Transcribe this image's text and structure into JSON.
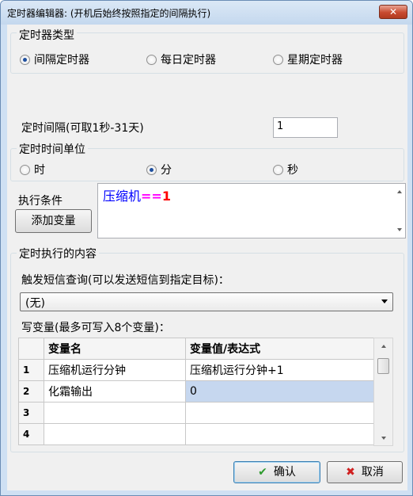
{
  "window": {
    "title": "定时器编辑器: (开机后始终按照指定的间隔执行)",
    "close_label": "✕"
  },
  "timer_type": {
    "group_title": "定时器类型",
    "options": [
      {
        "label": "间隔定时器",
        "selected": true
      },
      {
        "label": "每日定时器",
        "selected": false
      },
      {
        "label": "星期定时器",
        "selected": false
      }
    ]
  },
  "interval": {
    "label": "定时间隔(可取1秒-31天)",
    "value": "1"
  },
  "unit": {
    "group_title": "定时时间单位",
    "options": [
      {
        "label": "时",
        "selected": false
      },
      {
        "label": "分",
        "selected": true
      },
      {
        "label": "秒",
        "selected": false
      }
    ]
  },
  "condition": {
    "label": "执行条件",
    "add_variable_label": "添加变量",
    "expr_var": "压缩机",
    "expr_op": "==",
    "expr_val": "1",
    "colors": {
      "var": "#0000ff",
      "op": "#ff00ff",
      "val": "#ff0000"
    }
  },
  "content": {
    "group_title": "定时执行的内容",
    "sms_label": "触发短信查询(可以发送短信到指定目标)：",
    "sms_selected": "(无)",
    "write_label": "写变量(最多可写入8个变量)：",
    "table": {
      "headers": [
        "变量名",
        "变量值/表达式"
      ],
      "rows": [
        {
          "num": "1",
          "name": "压缩机运行分钟",
          "value": "压缩机运行分钟+1"
        },
        {
          "num": "2",
          "name": "化霜输出",
          "value": "0"
        },
        {
          "num": "3",
          "name": "",
          "value": ""
        },
        {
          "num": "4",
          "name": "",
          "value": ""
        }
      ]
    }
  },
  "buttons": {
    "ok_label": "确认",
    "cancel_label": "取消"
  },
  "colors": {
    "selection": "#c6d7ef",
    "ok_icon": "#2e9b2e",
    "cancel_icon": "#d02020"
  }
}
